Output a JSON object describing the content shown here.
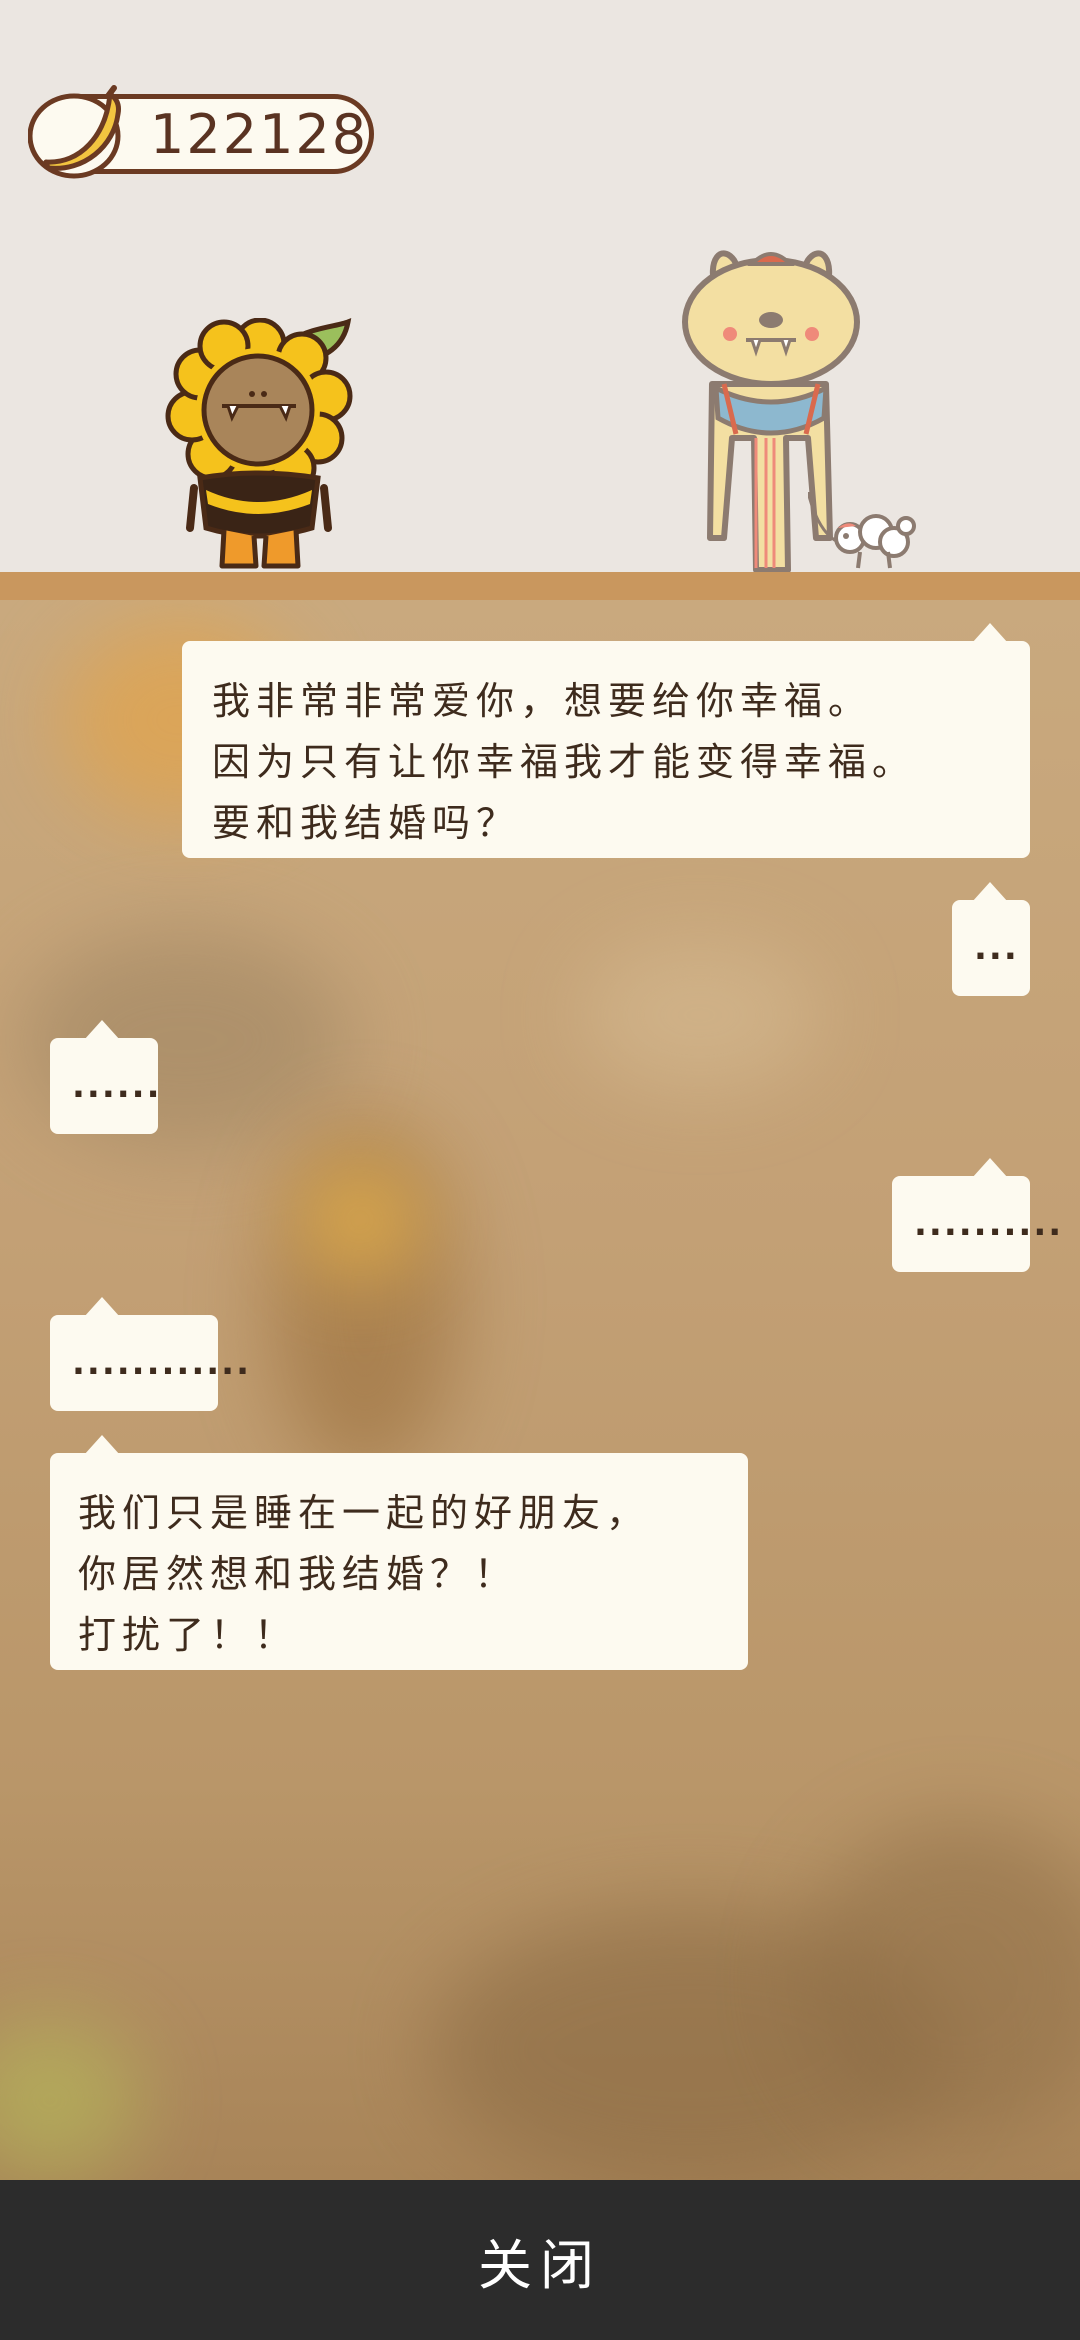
{
  "hud": {
    "banana_count": "122128",
    "banana_icon": "banana-icon"
  },
  "scene": {
    "characters": [
      "sunflower-character",
      "bunny-character",
      "puppy-character"
    ]
  },
  "dialog": [
    {
      "speaker": "bunny-character",
      "side": "right",
      "lines": [
        "我非常非常爱你，想要给你幸福。",
        "因为只有让你幸福我才能变得幸福。",
        "要和我结婚吗？"
      ]
    },
    {
      "speaker": "bunny-character",
      "side": "right",
      "lines": [
        "..."
      ]
    },
    {
      "speaker": "sunflower-character",
      "side": "left",
      "lines": [
        "......"
      ]
    },
    {
      "speaker": "bunny-character",
      "side": "right",
      "lines": [
        ".........."
      ]
    },
    {
      "speaker": "sunflower-character",
      "side": "left",
      "lines": [
        "............"
      ]
    },
    {
      "speaker": "sunflower-character",
      "side": "left",
      "lines": [
        "我们只是睡在一起的好朋友，",
        "你居然想和我结婚？！",
        "打扰了！！"
      ]
    }
  ],
  "footer": {
    "close_label": "关闭"
  },
  "colors": {
    "background": "#ebe6e1",
    "floor": "#c9975e",
    "bubble": "#fdfaf0",
    "text": "#3e2b1d",
    "footer": "#2c2c2c"
  }
}
